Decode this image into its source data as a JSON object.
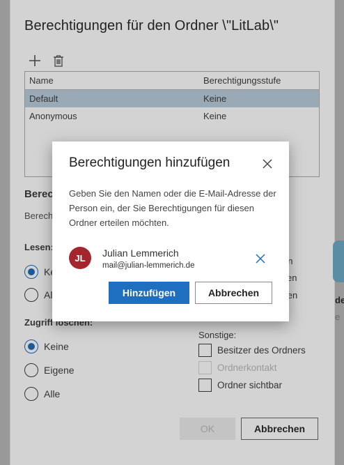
{
  "dialog": {
    "title": "Berechtigungen für den Ordner \\\"LitLab\\\"",
    "table": {
      "headers": [
        "Name",
        "Berechtigungsstufe"
      ],
      "rows": [
        {
          "name": "Default",
          "level": "Keine",
          "selected": true
        },
        {
          "name": "Anonymous",
          "level": "Keine",
          "selected": false
        }
      ]
    },
    "section_heading": "Berec",
    "section_sub": "Berech",
    "read_group": {
      "label": "Lesen:",
      "options": [
        "Kei",
        "All"
      ]
    },
    "delete_group": {
      "label": "Zugriff löschen:",
      "options": [
        "Keine",
        "Eigene",
        "Alle"
      ],
      "selected": "Keine"
    },
    "right_partials": [
      "en",
      "ellen",
      "eiten"
    ],
    "other_group": {
      "label": "Sonstige:",
      "options": [
        {
          "label": "Besitzer des Ordners",
          "disabled": false
        },
        {
          "label": "Ordnerkontakt",
          "disabled": true
        },
        {
          "label": "Ordner sichtbar",
          "disabled": false
        }
      ]
    },
    "ok_label": "OK",
    "cancel_label": "Abbrechen"
  },
  "far_right": [
    "de",
    "e"
  ],
  "modal": {
    "title": "Berechtigungen hinzufügen",
    "description": "Geben Sie den Namen oder die E-Mail-Adresse der Person ein, der Sie Berechtigungen für diesen Ordner erteilen möchten.",
    "user": {
      "initials": "JL",
      "name": "Julian Lemmerich",
      "email": "mail@julian-lemmerich.de",
      "avatar_color": "#a4262c"
    },
    "add_label": "Hinzufügen",
    "cancel_label": "Abbrechen"
  },
  "colors": {
    "accent": "#1e6fbf",
    "selected_row": "#9aa9b6"
  },
  "icons": {
    "add": "plus-icon",
    "delete": "trash-icon",
    "close": "close-icon",
    "remove_user": "remove-icon"
  }
}
